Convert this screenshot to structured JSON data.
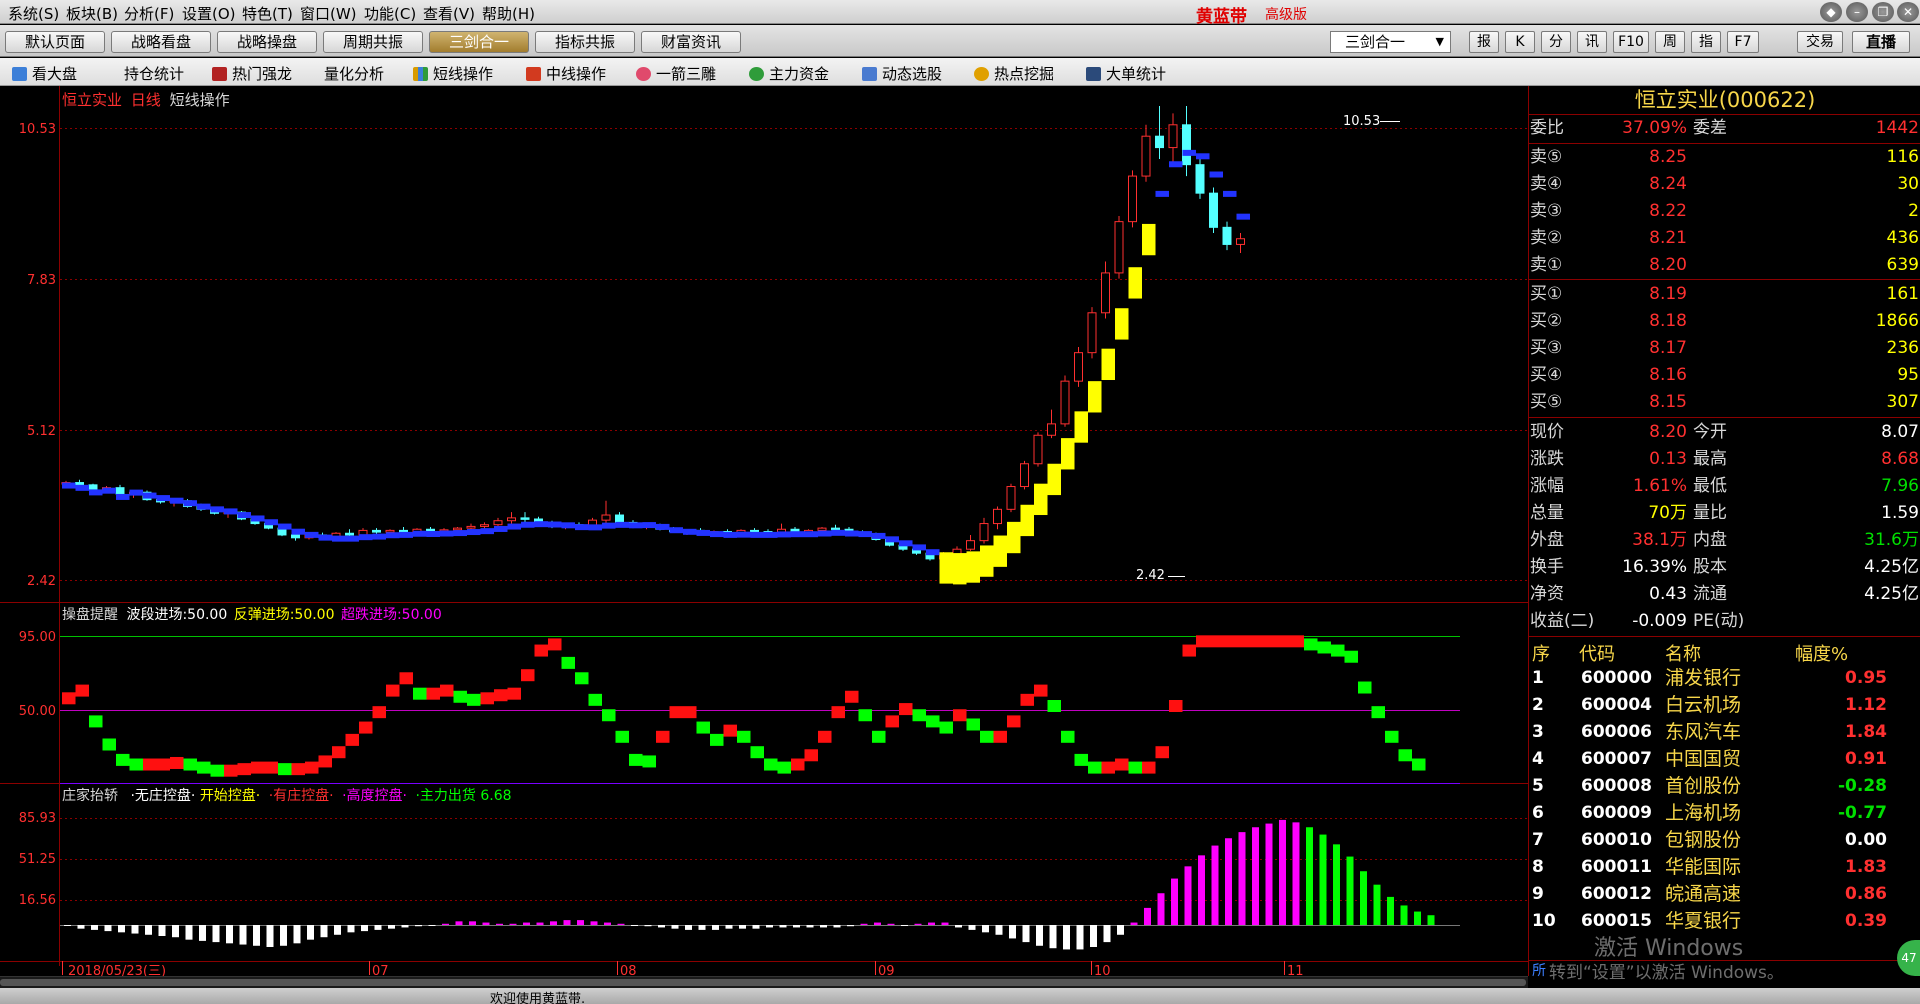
{
  "menu": [
    "系统(S)",
    "板块(B)",
    "分析(F)",
    "设置(O)",
    "特色(T)",
    "窗口(W)",
    "功能(C)",
    "查看(V)",
    "帮助(H)"
  ],
  "brand": {
    "name": "黄蓝带",
    "edition": "高级版"
  },
  "tabs": [
    "默认页面",
    "战略看盘",
    "战略操盘",
    "周期共振",
    "三剑合一",
    "指标共振",
    "财富资讯"
  ],
  "active_tab": "三剑合一",
  "combo": {
    "value": "三剑合一"
  },
  "toolbar_buttons": [
    "报",
    "K",
    "分",
    "讯",
    "F10",
    "周",
    "指",
    "F7"
  ],
  "trade_button": "交易",
  "live_button": "直播",
  "functions": [
    {
      "label": "看大盘",
      "icon": "market-icon",
      "color": "#3c7fd8"
    },
    {
      "label": "持仓统计",
      "icon": "",
      "color": ""
    },
    {
      "label": "热门强龙",
      "icon": "dragon-icon",
      "color": "#b22222"
    },
    {
      "label": "量化分析",
      "icon": "",
      "color": ""
    },
    {
      "label": "短线操作",
      "icon": "bars-icon",
      "color": "#d89b00"
    },
    {
      "label": "中线操作",
      "icon": "trend-icon",
      "color": "#d23a1f"
    },
    {
      "label": "一箭三雕",
      "icon": "arrow-icon",
      "color": "#e04a6c"
    },
    {
      "label": "主力资金",
      "icon": "fund-icon",
      "color": "#2f9c3a"
    },
    {
      "label": "动态选股",
      "icon": "chart-icon",
      "color": "#4a7bd0"
    },
    {
      "label": "热点挖掘",
      "icon": "hot-icon",
      "color": "#e0a000"
    },
    {
      "label": "大单统计",
      "icon": "stats-icon",
      "color": "#2b4a7a"
    }
  ],
  "chart": {
    "stock_name": "恒立实业",
    "period": "日线",
    "indicator": "短线操作",
    "price_ticks": [
      "10.53",
      "7.83",
      "5.12",
      "2.42"
    ],
    "high_label": "10.53",
    "low_label": "2.42",
    "pane2": {
      "title": "操盘提醒",
      "items": [
        {
          "label": "波段进场:50.00",
          "color": "#ffffff"
        },
        {
          "label": "反弹进场:50.00",
          "color": "#ffff00"
        },
        {
          "label": "超跌进场:50.00",
          "color": "#ff00ff"
        }
      ],
      "ticks": [
        "95.00",
        "50.00"
      ]
    },
    "pane3": {
      "title": "庄家抬轿",
      "items": [
        {
          "label": "·无庄控盘·",
          "color": "#ffffff"
        },
        {
          "label": "开始控盘·",
          "color": "#ffff00"
        },
        {
          "label": "·有庄控盘·",
          "color": "#ff3030"
        },
        {
          "label": "·高度控盘·",
          "color": "#ff00ff"
        },
        {
          "label": "·主力出货 6.68",
          "color": "#00ff00"
        }
      ],
      "ticks": [
        "85.93",
        "51.25",
        "16.56"
      ]
    },
    "date_axis": [
      "2018/05/23(三)",
      "07",
      "08",
      "09",
      "10",
      "11"
    ],
    "chart_data": [
      {
        "type": "candlestick",
        "title": "恒立实业 日线 短线操作",
        "ylim": [
          2.42,
          10.53
        ],
        "candles": [
          [
            3.9,
            3.95,
            3.86,
            3.92
          ],
          [
            3.92,
            3.97,
            3.86,
            3.88
          ],
          [
            3.88,
            3.9,
            3.78,
            3.8
          ],
          [
            3.8,
            3.86,
            3.75,
            3.83
          ],
          [
            3.83,
            3.88,
            3.7,
            3.72
          ],
          [
            3.72,
            3.78,
            3.65,
            3.75
          ],
          [
            3.75,
            3.78,
            3.6,
            3.62
          ],
          [
            3.62,
            3.66,
            3.55,
            3.58
          ],
          [
            3.58,
            3.64,
            3.5,
            3.6
          ],
          [
            3.6,
            3.63,
            3.48,
            3.5
          ],
          [
            3.5,
            3.55,
            3.42,
            3.45
          ],
          [
            3.45,
            3.5,
            3.36,
            3.38
          ],
          [
            3.38,
            3.43,
            3.3,
            3.4
          ],
          [
            3.4,
            3.42,
            3.26,
            3.28
          ],
          [
            3.28,
            3.32,
            3.18,
            3.2
          ],
          [
            3.2,
            3.25,
            3.1,
            3.12
          ],
          [
            3.12,
            3.15,
            2.98,
            3.0
          ],
          [
            3.0,
            3.05,
            2.9,
            2.95
          ],
          [
            2.95,
            3.02,
            2.92,
            3.0
          ],
          [
            3.0,
            3.04,
            2.93,
            2.96
          ],
          [
            2.96,
            3.05,
            2.9,
            3.03
          ],
          [
            3.03,
            3.1,
            2.98,
            3.0
          ],
          [
            3.0,
            3.12,
            2.98,
            3.08
          ],
          [
            3.08,
            3.12,
            3.02,
            3.05
          ],
          [
            3.05,
            3.1,
            3.0,
            3.08
          ],
          [
            3.08,
            3.14,
            3.04,
            3.06
          ],
          [
            3.06,
            3.12,
            3.02,
            3.1
          ],
          [
            3.1,
            3.14,
            3.04,
            3.06
          ],
          [
            3.06,
            3.12,
            3.03,
            3.09
          ],
          [
            3.09,
            3.14,
            3.06,
            3.12
          ],
          [
            3.12,
            3.2,
            3.08,
            3.15
          ],
          [
            3.15,
            3.22,
            3.1,
            3.18
          ],
          [
            3.18,
            3.3,
            3.14,
            3.25
          ],
          [
            3.25,
            3.4,
            3.2,
            3.3
          ],
          [
            3.3,
            3.4,
            3.22,
            3.28
          ],
          [
            3.28,
            3.32,
            3.18,
            3.2
          ],
          [
            3.2,
            3.25,
            3.12,
            3.15
          ],
          [
            3.15,
            3.2,
            3.1,
            3.18
          ],
          [
            3.18,
            3.22,
            3.1,
            3.14
          ],
          [
            3.14,
            3.3,
            3.12,
            3.26
          ],
          [
            3.26,
            3.6,
            3.2,
            3.35
          ],
          [
            3.35,
            3.4,
            3.2,
            3.22
          ],
          [
            3.22,
            3.26,
            3.12,
            3.14
          ],
          [
            3.14,
            3.2,
            3.1,
            3.16
          ],
          [
            3.16,
            3.2,
            3.08,
            3.1
          ],
          [
            3.1,
            3.14,
            3.04,
            3.06
          ],
          [
            3.06,
            3.1,
            3.0,
            3.08
          ],
          [
            3.08,
            3.12,
            3.02,
            3.04
          ],
          [
            3.04,
            3.08,
            3.0,
            3.06
          ],
          [
            3.06,
            3.1,
            3.02,
            3.03
          ],
          [
            3.03,
            3.1,
            3.0,
            3.08
          ],
          [
            3.08,
            3.12,
            3.04,
            3.06
          ],
          [
            3.06,
            3.1,
            3.02,
            3.04
          ],
          [
            3.04,
            3.2,
            3.02,
            3.1
          ],
          [
            3.1,
            3.14,
            3.02,
            3.05
          ],
          [
            3.05,
            3.1,
            3.02,
            3.08
          ],
          [
            3.08,
            3.14,
            3.05,
            3.12
          ],
          [
            3.12,
            3.18,
            3.08,
            3.1
          ],
          [
            3.1,
            3.14,
            3.02,
            3.04
          ],
          [
            3.04,
            3.08,
            2.98,
            3.0
          ],
          [
            3.0,
            3.04,
            2.9,
            2.92
          ],
          [
            2.92,
            2.96,
            2.8,
            2.82
          ],
          [
            2.82,
            2.86,
            2.72,
            2.75
          ],
          [
            2.75,
            2.8,
            2.65,
            2.68
          ],
          [
            2.68,
            2.72,
            2.55,
            2.58
          ],
          [
            2.58,
            2.7,
            2.42,
            2.65
          ],
          [
            2.65,
            2.8,
            2.6,
            2.75
          ],
          [
            2.75,
            3.0,
            2.72,
            2.9
          ],
          [
            2.9,
            3.3,
            2.85,
            3.2
          ],
          [
            3.2,
            3.5,
            3.1,
            3.45
          ],
          [
            3.45,
            3.9,
            3.4,
            3.85
          ],
          [
            3.85,
            4.3,
            3.8,
            4.25
          ],
          [
            4.25,
            4.8,
            4.2,
            4.75
          ],
          [
            4.75,
            5.2,
            4.7,
            4.95
          ],
          [
            4.95,
            5.8,
            4.9,
            5.7
          ],
          [
            5.7,
            6.3,
            5.6,
            6.2
          ],
          [
            6.2,
            7.0,
            6.1,
            6.9
          ],
          [
            6.9,
            7.8,
            6.8,
            7.6
          ],
          [
            7.6,
            8.6,
            7.5,
            8.5
          ],
          [
            8.5,
            9.4,
            8.4,
            9.3
          ],
          [
            9.3,
            10.2,
            9.2,
            10.0
          ],
          [
            10.0,
            10.53,
            9.6,
            9.8
          ],
          [
            9.8,
            10.4,
            9.5,
            10.2
          ],
          [
            10.2,
            10.53,
            9.3,
            9.5
          ],
          [
            9.5,
            9.6,
            8.9,
            9.0
          ],
          [
            9.0,
            9.1,
            8.3,
            8.4
          ],
          [
            8.4,
            8.5,
            8.0,
            8.1
          ],
          [
            8.1,
            8.3,
            7.95,
            8.2
          ]
        ]
      },
      {
        "type": "bar",
        "title": "操盘提醒",
        "ylim": [
          0,
          100
        ],
        "values": [
          55,
          60,
          40,
          25,
          15,
          12,
          12,
          12,
          13,
          12,
          10,
          8,
          8,
          9,
          10,
          10,
          9,
          9,
          10,
          14,
          20,
          28,
          36,
          46,
          60,
          68,
          58,
          58,
          60,
          56,
          54,
          55,
          57,
          58,
          70,
          86,
          90,
          78,
          68,
          54,
          44,
          30,
          15,
          14,
          30,
          46,
          46,
          36,
          28,
          34,
          30,
          20,
          12,
          10,
          12,
          18,
          30,
          46,
          56,
          44,
          30,
          40,
          48,
          44,
          40,
          36,
          44,
          38,
          30,
          30,
          40,
          54,
          60,
          50,
          30,
          15,
          10,
          10,
          12,
          10,
          10,
          20,
          50,
          86,
          92,
          92,
          92,
          92,
          92,
          92,
          92,
          92,
          90,
          88,
          86,
          82,
          62,
          46,
          30,
          18,
          12
        ]
      },
      {
        "type": "bar",
        "title": "庄家抬轿",
        "ylim": [
          -22,
          85.93
        ],
        "values": [
          0,
          -3,
          -4,
          -5,
          -6,
          -7,
          -8,
          -9,
          -10,
          -12,
          -13,
          -14,
          -15,
          -16,
          -17,
          -18,
          -17,
          -15,
          -12,
          -10,
          -8,
          -6,
          -5,
          -4,
          -3,
          -2,
          -1,
          0,
          1,
          3,
          3,
          2,
          1,
          1,
          2,
          2,
          3,
          4,
          4,
          3,
          2,
          1,
          0,
          -1,
          -2,
          -3,
          -4,
          -4,
          -4,
          -3,
          -3,
          -3,
          -2,
          -2,
          -2,
          -2,
          -2,
          -2,
          -1,
          1,
          2,
          1,
          0,
          1,
          2,
          2,
          -2,
          -4,
          -6,
          -8,
          -11,
          -14,
          -17,
          -19,
          -20,
          -20,
          -18,
          -14,
          -8,
          2,
          14,
          26,
          38,
          48,
          57,
          65,
          71,
          76,
          80,
          83,
          86,
          84,
          80,
          74,
          66,
          56,
          44,
          33,
          23,
          16,
          11,
          8
        ]
      }
    ]
  },
  "quote": {
    "title": "恒立实业(000622)",
    "weibi_label": "委比",
    "weibi": "37.09%",
    "weicha_label": "委差",
    "weicha": "1442",
    "asks": [
      {
        "label": "卖⑤",
        "price": "8.25",
        "vol": "116"
      },
      {
        "label": "卖④",
        "price": "8.24",
        "vol": "30"
      },
      {
        "label": "卖③",
        "price": "8.22",
        "vol": "2"
      },
      {
        "label": "卖②",
        "price": "8.21",
        "vol": "436"
      },
      {
        "label": "卖①",
        "price": "8.20",
        "vol": "639"
      }
    ],
    "bids": [
      {
        "label": "买①",
        "price": "8.19",
        "vol": "161"
      },
      {
        "label": "买②",
        "price": "8.18",
        "vol": "1866"
      },
      {
        "label": "买③",
        "price": "8.17",
        "vol": "236"
      },
      {
        "label": "买④",
        "price": "8.16",
        "vol": "95"
      },
      {
        "label": "买⑤",
        "price": "8.15",
        "vol": "307"
      }
    ],
    "stats": [
      {
        "l1": "现价",
        "v1": "8.20",
        "c1": "#ff3030",
        "l2": "今开",
        "v2": "8.07",
        "c2": "#ffffff"
      },
      {
        "l1": "涨跌",
        "v1": "0.13",
        "c1": "#ff3030",
        "l2": "最高",
        "v2": "8.68",
        "c2": "#ff3030"
      },
      {
        "l1": "涨幅",
        "v1": "1.61%",
        "c1": "#ff3030",
        "l2": "最低",
        "v2": "7.96",
        "c2": "#00e000"
      },
      {
        "l1": "总量",
        "v1": "70万",
        "c1": "#ffff00",
        "l2": "量比",
        "v2": "1.59",
        "c2": "#ffffff"
      },
      {
        "l1": "外盘",
        "v1": "38.1万",
        "c1": "#ff3030",
        "l2": "内盘",
        "v2": "31.6万",
        "c2": "#00e000"
      },
      {
        "l1": "换手",
        "v1": "16.39%",
        "c1": "#ffffff",
        "l2": "股本",
        "v2": "4.25亿",
        "c2": "#ffffff"
      },
      {
        "l1": "净资",
        "v1": "0.43",
        "c1": "#ffffff",
        "l2": "流通",
        "v2": "4.25亿",
        "c2": "#ffffff"
      },
      {
        "l1": "收益(二)",
        "v1": "-0.009",
        "c1": "#ffffff",
        "l2": "PE(动)",
        "v2": "",
        "c2": "#ffffff"
      }
    ]
  },
  "stock_list": {
    "headers": [
      "序",
      "代码",
      "名称",
      "幅度%"
    ],
    "rows": [
      {
        "no": "1",
        "code": "600000",
        "name": "浦发银行",
        "pct": "0.95",
        "color": "#ff3030"
      },
      {
        "no": "2",
        "code": "600004",
        "name": "白云机场",
        "pct": "1.12",
        "color": "#ff3030"
      },
      {
        "no": "3",
        "code": "600006",
        "name": "东风汽车",
        "pct": "1.84",
        "color": "#ff3030"
      },
      {
        "no": "4",
        "code": "600007",
        "name": "中国国贸",
        "pct": "0.91",
        "color": "#ff3030"
      },
      {
        "no": "5",
        "code": "600008",
        "name": "首创股份",
        "pct": "-0.28",
        "color": "#00e000"
      },
      {
        "no": "6",
        "code": "600009",
        "name": "上海机场",
        "pct": "-0.77",
        "color": "#00e000"
      },
      {
        "no": "7",
        "code": "600010",
        "name": "包钢股份",
        "pct": "0.00",
        "color": "#ffffff"
      },
      {
        "no": "8",
        "code": "600011",
        "name": "华能国际",
        "pct": "1.83",
        "color": "#ff3030"
      },
      {
        "no": "9",
        "code": "600012",
        "name": "皖通高速",
        "pct": "0.86",
        "color": "#ff3030"
      },
      {
        "no": "10",
        "code": "600015",
        "name": "华夏银行",
        "pct": "0.39",
        "color": "#ff3030"
      }
    ],
    "footer_tab": "所"
  },
  "status": {
    "message": "欢迎使用黄蓝带."
  },
  "watermark": {
    "line1": "激活 Windows",
    "line2": "转到“设置”以激活 Windows。"
  },
  "badge": "47"
}
